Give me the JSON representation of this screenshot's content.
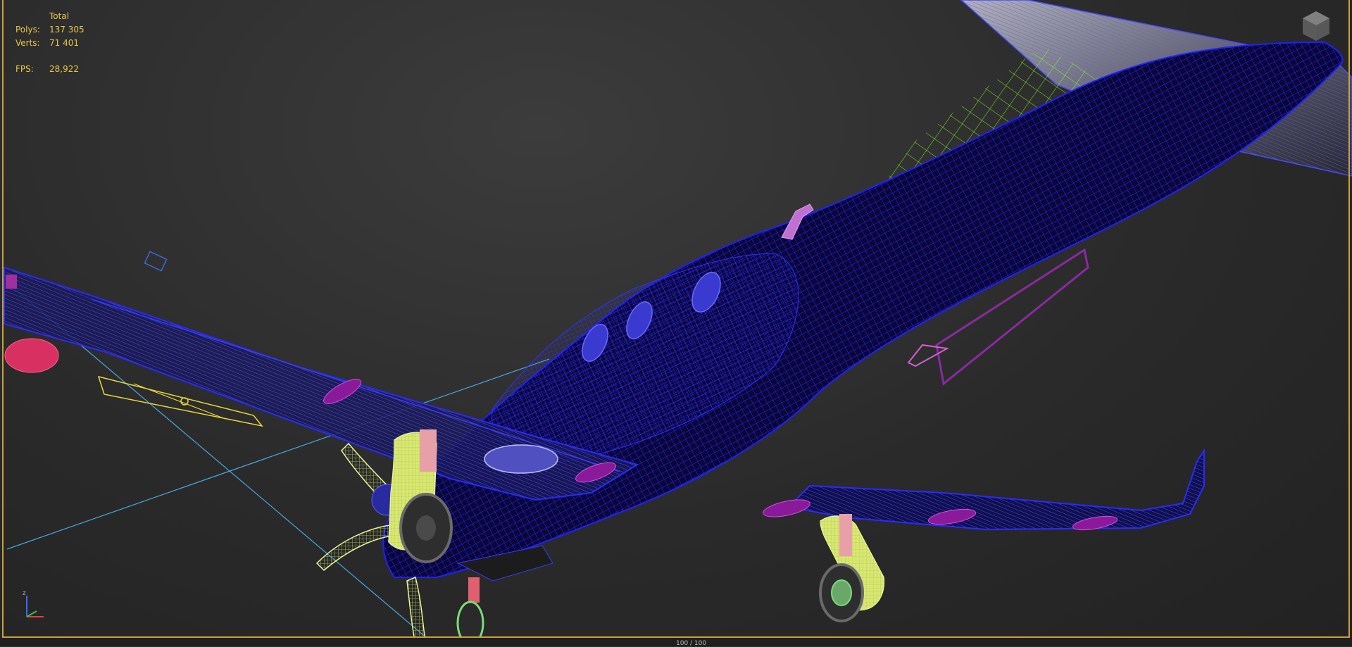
{
  "viewport_stats": {
    "header": "Total",
    "polys_label": "Polys:",
    "polys_value": "137 305",
    "verts_label": "Verts:",
    "verts_value": "71 401",
    "fps_label": "FPS:",
    "fps_value": "28,922"
  },
  "axis": {
    "z_label": "z"
  },
  "timeslider": {
    "label": "100 / 100"
  },
  "colors": {
    "stats_text": "#e8c84a",
    "viewport_border": "#c8a03c",
    "fuselage_wire": "#1a1aff",
    "fuselage_fill": "#0a0638",
    "canopy_wire": "#88ff22",
    "gear_wire": "#e8f59a",
    "highlight_wire": "#d040d0",
    "helper_line": "#4aa8e0",
    "light_helper": "#e8d838"
  }
}
